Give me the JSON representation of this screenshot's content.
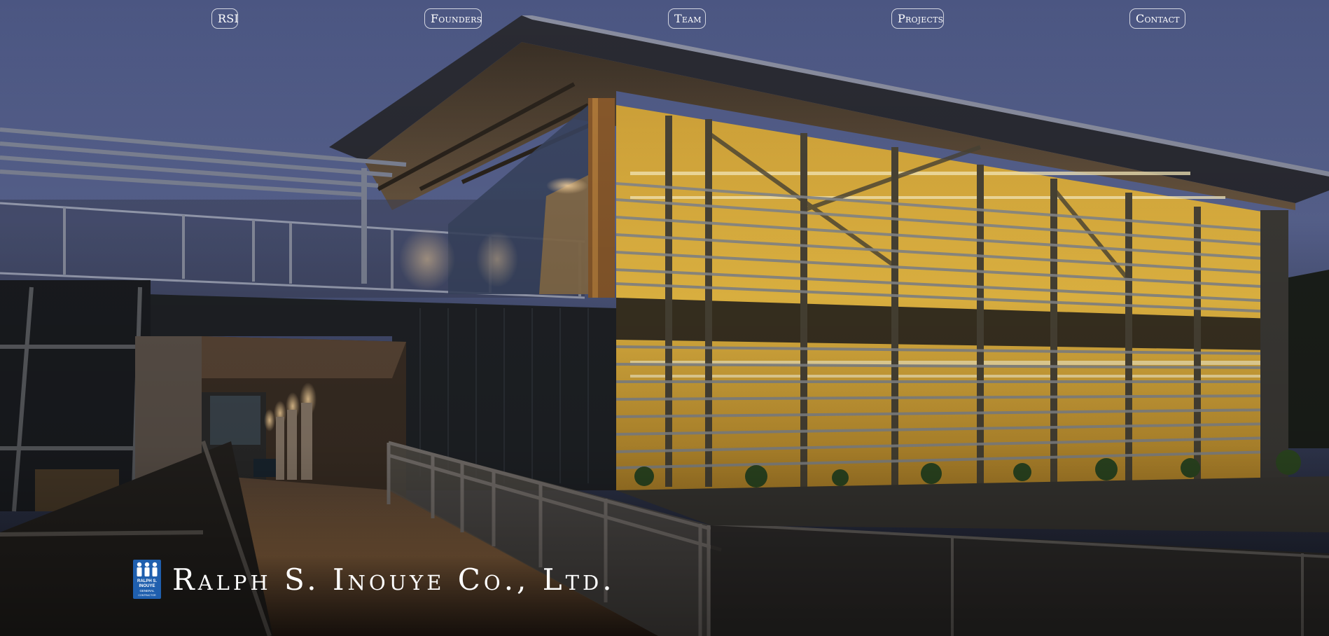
{
  "nav": {
    "items": [
      {
        "label": "RSI"
      },
      {
        "label": "Founders"
      },
      {
        "label": "Team"
      },
      {
        "label": "Projects"
      },
      {
        "label": "Contact"
      }
    ]
  },
  "brand": {
    "name": "Ralph S. Inouye Co., Ltd.",
    "logo_text_1": "RALPH S.",
    "logo_text_2": "INOUYE",
    "logo_text_3": "GENERAL",
    "logo_text_4": "CONTRACTOR"
  },
  "colors": {
    "sky": "#4f5a86",
    "window_glow": "#e8b73c",
    "logo_blue": "#1f5fae",
    "text": "#ffffff"
  }
}
